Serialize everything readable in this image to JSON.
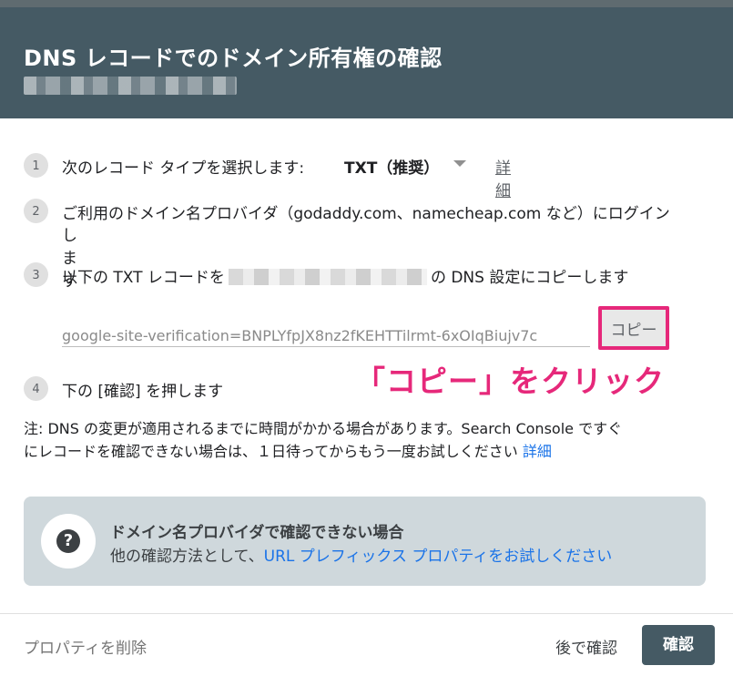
{
  "dialog": {
    "title": "DNS レコードでのドメイン所有権の確認"
  },
  "steps": {
    "s1": {
      "num": "1",
      "text": "次のレコード タイプを選択します:",
      "record_type": "TXT（推奨）",
      "detail_link": "詳細"
    },
    "s2": {
      "num": "2",
      "line1": "ご利用のドメイン名プロバイダ（godaddy.com、namecheap.com など）にログイン",
      "line2": "します"
    },
    "s3": {
      "num": "3",
      "text_before": "以下の TXT レコードを",
      "text_after": "の DNS 設定にコピーします",
      "record_value": "google-site-verification=BNPLYfpJX8nz2fKEHTTilrmt-6xOIqBiujv7c",
      "copy_label": "コピー"
    },
    "s4": {
      "num": "4",
      "text": "下の [確認] を押します"
    }
  },
  "annotation": {
    "text": "「コピー」をクリック",
    "color": "#e6287a"
  },
  "note": {
    "line1": "注: DNS の変更が適用されるまでに時間がかかる場合があります。Search Console ですぐ",
    "line2": "にレコードを確認できない場合は、１日待ってからもう一度お試しください",
    "link": "詳細"
  },
  "help_box": {
    "icon": "help-icon",
    "heading": "ドメイン名プロバイダで確認できない場合",
    "body_prefix": "他の確認方法として、",
    "body_link": "URL プレフィックス プロパティをお試しください"
  },
  "footer": {
    "delete_label": "プロパティを削除",
    "later_label": "後で確認",
    "confirm_label": "確認"
  },
  "colors": {
    "header_bg": "#455a64",
    "accent_link": "#1a73e8",
    "highlight": "#e6287a"
  }
}
